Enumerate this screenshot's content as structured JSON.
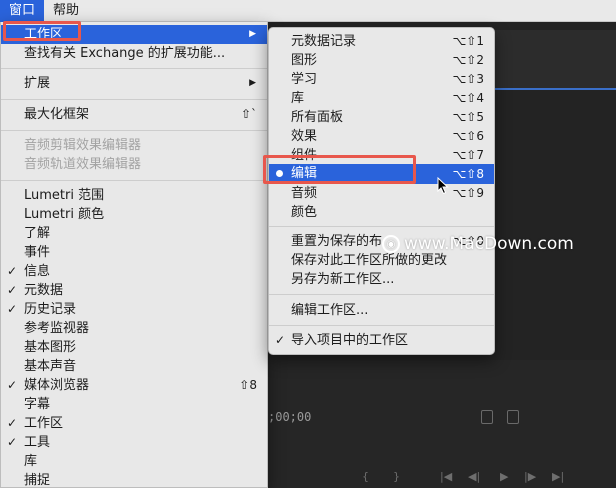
{
  "menubar": {
    "items": [
      "窗口",
      "帮助"
    ],
    "active": "窗口"
  },
  "main_menu": {
    "items": {
      "workspaces": {
        "label": "工作区"
      },
      "find_ext": {
        "label": "查找有关 Exchange 的扩展功能..."
      },
      "extensions": {
        "label": "扩展"
      },
      "maximize": {
        "label": "最大化框架",
        "shortcut": "⇧`"
      },
      "audio_clip_fx": {
        "label": "音频剪辑效果编辑器"
      },
      "audio_track_fx": {
        "label": "音频轨道效果编辑器"
      },
      "lumetri_scopes": {
        "label": "Lumetri 范围"
      },
      "lumetri_color": {
        "label": "Lumetri 颜色"
      },
      "learn": {
        "label": "了解"
      },
      "events": {
        "label": "事件",
        "check": ""
      },
      "info": {
        "label": "信息",
        "check": "✓"
      },
      "metadata": {
        "label": "元数据",
        "check": "✓"
      },
      "history": {
        "label": "历史记录",
        "check": "✓"
      },
      "ref_monitor": {
        "label": "参考监视器"
      },
      "essential_graphics": {
        "label": "基本图形"
      },
      "essential_sound": {
        "label": "基本声音"
      },
      "media_browser": {
        "label": "媒体浏览器",
        "check": "✓",
        "shortcut": "⇧8"
      },
      "captions": {
        "label": "字幕"
      },
      "workspaces_panel": {
        "label": "工作区",
        "check": "✓"
      },
      "tools": {
        "label": "工具",
        "check": "✓"
      },
      "library": {
        "label": "库"
      },
      "capture": {
        "label": "捕捉"
      }
    }
  },
  "sub_menu": {
    "items": {
      "metadata_logging": {
        "label": "元数据记录",
        "shortcut": "⌥⇧1"
      },
      "graphics": {
        "label": "图形",
        "shortcut": "⌥⇧2"
      },
      "learning": {
        "label": "学习",
        "shortcut": "⌥⇧3"
      },
      "libraries": {
        "label": "库",
        "shortcut": "⌥⇧4"
      },
      "all_panels": {
        "label": "所有面板",
        "shortcut": "⌥⇧5"
      },
      "effects": {
        "label": "效果",
        "shortcut": "⌥⇧6"
      },
      "assembly": {
        "label": "组件",
        "shortcut": "⌥⇧7"
      },
      "editing": {
        "label": "编辑",
        "shortcut": "⌥⇧8"
      },
      "audio": {
        "label": "音频",
        "shortcut": "⌥⇧9"
      },
      "color": {
        "label": "颜色"
      },
      "reset_saved": {
        "label": "重置为保存的布",
        "shortcut": "⌥⇧0"
      },
      "save_changes": {
        "label": "保存对此工作区所做的更改"
      },
      "save_new": {
        "label": "另存为新工作区..."
      },
      "edit_workspaces": {
        "label": "编辑工作区..."
      },
      "import_from_project": {
        "label": "导入项目中的工作区",
        "check": "✓"
      }
    }
  },
  "app": {
    "timecode": ";00;00"
  },
  "watermark": {
    "text": "www.MacDown.com"
  },
  "colors": {
    "highlight": "#2a63db",
    "annotation": "#e8574c",
    "menu_bg": "#e8e8e8"
  }
}
